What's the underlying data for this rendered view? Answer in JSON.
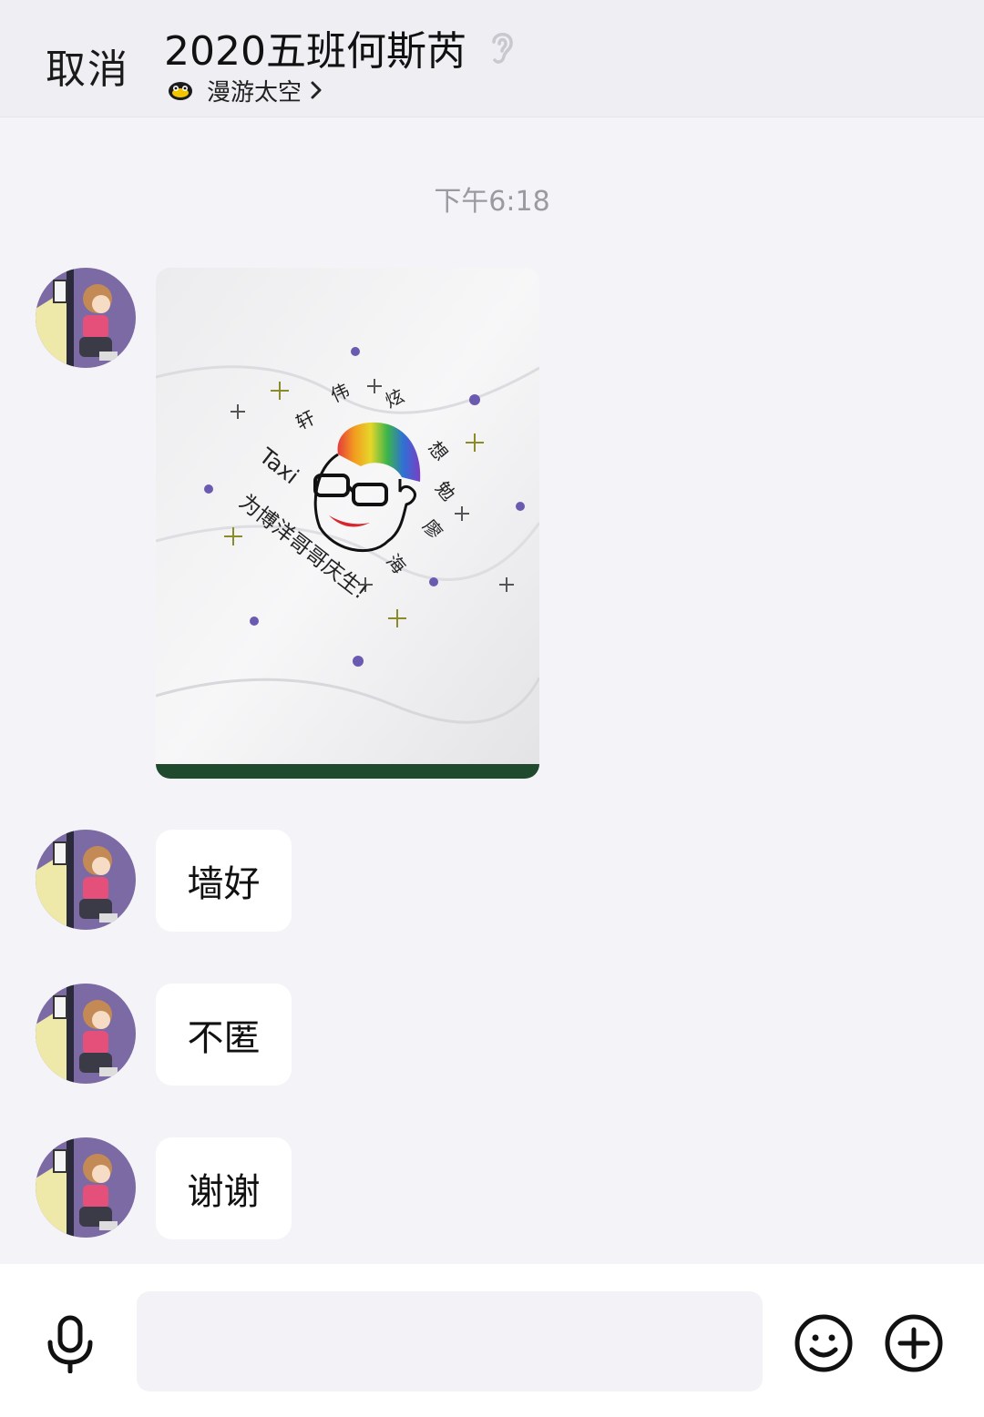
{
  "header": {
    "cancel_label": "取消",
    "title": "2020五班何斯芮",
    "subtitle": "漫游太空"
  },
  "chat": {
    "timestamp": "下午6:18",
    "image_text": {
      "top_arc": [
        "伟",
        "炫",
        "轩"
      ],
      "right_col": [
        "想",
        "勉",
        "廖",
        "海"
      ],
      "taxi": "Taxi",
      "bottom_line": "为博洋哥哥庆生!"
    },
    "messages": [
      {
        "text": "墙好"
      },
      {
        "text": "不匿"
      },
      {
        "text": "谢谢"
      }
    ]
  },
  "colors": {
    "background": "#f4f3f7",
    "header_bg": "#efeef3",
    "bubble_bg": "#ffffff",
    "timestamp": "#9b9aa1"
  },
  "icons": [
    "ear-icon",
    "bot-icon",
    "chevron-right-icon",
    "mic-icon",
    "emoji-icon",
    "plus-icon"
  ]
}
